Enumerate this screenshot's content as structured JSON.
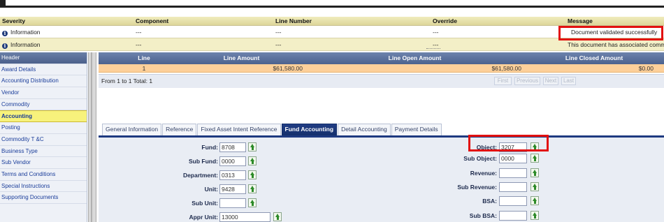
{
  "messages": {
    "columns": [
      "Severity",
      "Component",
      "Line Number",
      "Override",
      "Message"
    ],
    "rows": [
      {
        "severity": "Information",
        "component": "---",
        "line_number": "---",
        "override": "---",
        "message": "Document validated successfully"
      },
      {
        "severity": "Information",
        "component": "---",
        "line_number": "---",
        "override": "---",
        "message": "This document has associated comments"
      }
    ]
  },
  "sidebar": {
    "items": [
      "Header",
      "Award Details",
      "Accounting Distribution",
      "Vendor",
      "Commodity",
      "Accounting",
      "Posting",
      "Commodity T &C",
      "Business Type",
      "Sub Vendor",
      "Terms and Conditions",
      "Special Instructions",
      "Supporting Documents"
    ],
    "active": "Accounting"
  },
  "lines_grid": {
    "columns": [
      "Line",
      "Line Amount",
      "Line Open Amount",
      "Line Closed Amount"
    ],
    "row": {
      "line": "1",
      "line_amount": "$61,580.00",
      "open_amount": "$61,580.00",
      "closed_amount": "$0.00"
    },
    "pager_text": "From 1 to 1 Total: 1",
    "pager_buttons": [
      "First",
      "Previous",
      "Next",
      "Last"
    ]
  },
  "tabs": [
    "General Information",
    "Reference",
    "Fixed Asset Intent Reference",
    "Fund Accounting",
    "Detail Accounting",
    "Payment Details"
  ],
  "active_tab": "Fund Accounting",
  "form": {
    "left": [
      {
        "label": "Fund:",
        "value": "8708"
      },
      {
        "label": "Sub Fund:",
        "value": "0000"
      },
      {
        "label": "Department:",
        "value": "0313"
      },
      {
        "label": "Unit:",
        "value": "9428"
      },
      {
        "label": "Sub Unit:",
        "value": ""
      },
      {
        "label": "Appr Unit:",
        "value": "13000"
      }
    ],
    "right": [
      {
        "label": "Object:",
        "value": "3207"
      },
      {
        "label": "Sub Object:",
        "value": "0000"
      },
      {
        "label": "Revenue:",
        "value": ""
      },
      {
        "label": "Sub Revenue:",
        "value": ""
      },
      {
        "label": "BSA:",
        "value": ""
      },
      {
        "label": "Sub BSA:",
        "value": ""
      }
    ]
  },
  "colors": {
    "highlight_box": "#e21010",
    "header_gold": "#ddd69a",
    "grid_header": "#5a6f9b",
    "selected_row": "#fdd09a",
    "active_tab": "#1e3a80",
    "active_nav": "#f7f27c"
  },
  "icons": {
    "info": "info-icon",
    "lookup": "lookup-arrow-icon"
  }
}
